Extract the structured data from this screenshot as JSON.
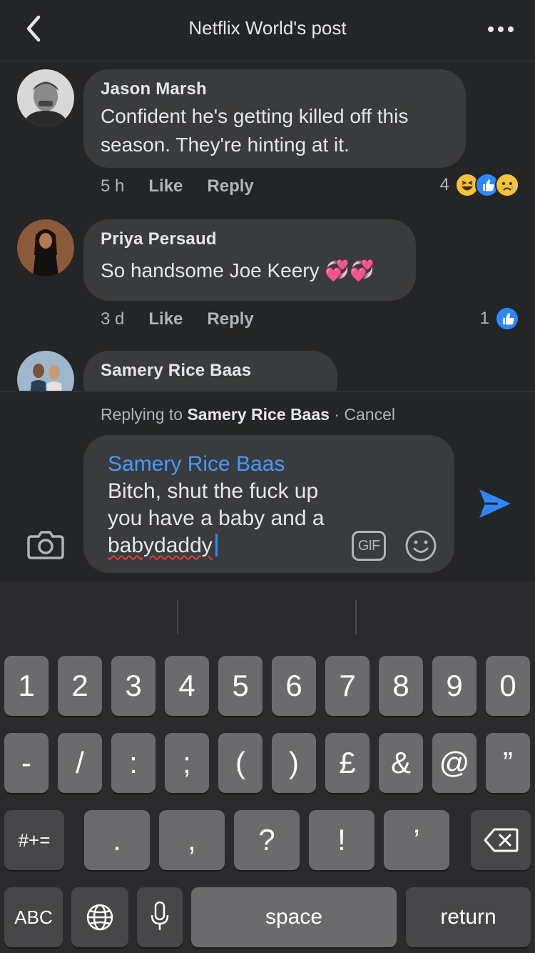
{
  "header": {
    "title": "Netflix World's post"
  },
  "comments": [
    {
      "author": "Jason Marsh",
      "text_lines": [
        "Confident he's getting killed off this",
        "season. They're hinting at it."
      ],
      "time": "5 h",
      "like_label": "Like",
      "reply_label": "Reply",
      "reaction_count": "4",
      "reactions": [
        "laughing-emoji-icon",
        "like-icon",
        "sad-emoji-icon"
      ]
    },
    {
      "author": "Priya Persaud",
      "text": "So handsome Joe Keery 💞💞",
      "time": "3 d",
      "like_label": "Like",
      "reply_label": "Reply",
      "reaction_count": "1",
      "reactions": [
        "like-icon"
      ]
    },
    {
      "author": "Samery Rice Baas"
    }
  ],
  "reply": {
    "prefix": "Replying to",
    "target": "Samery Rice Baas",
    "cancel": "· Cancel",
    "mention": "Samery Rice Baas",
    "line1": "Bitch, shut the fuck up",
    "line2": "you have a baby and a",
    "line3": "babydaddy",
    "gif_label": "GIF"
  },
  "keyboard": {
    "row1": [
      "1",
      "2",
      "3",
      "4",
      "5",
      "6",
      "7",
      "8",
      "9",
      "0"
    ],
    "row2": [
      "-",
      "/",
      ":",
      ";",
      "(",
      ")",
      "£",
      "&",
      "@",
      "”"
    ],
    "row3": {
      "mode": "#+=",
      "keys": [
        ".",
        ",",
        "?",
        "!",
        "’"
      ]
    },
    "row4": {
      "abc": "ABC",
      "space": "space",
      "return": "return"
    }
  },
  "colors": {
    "background": "#242526",
    "bubble": "#3a3b3c",
    "accent": "#2d88ff",
    "mention": "#4599ff"
  }
}
